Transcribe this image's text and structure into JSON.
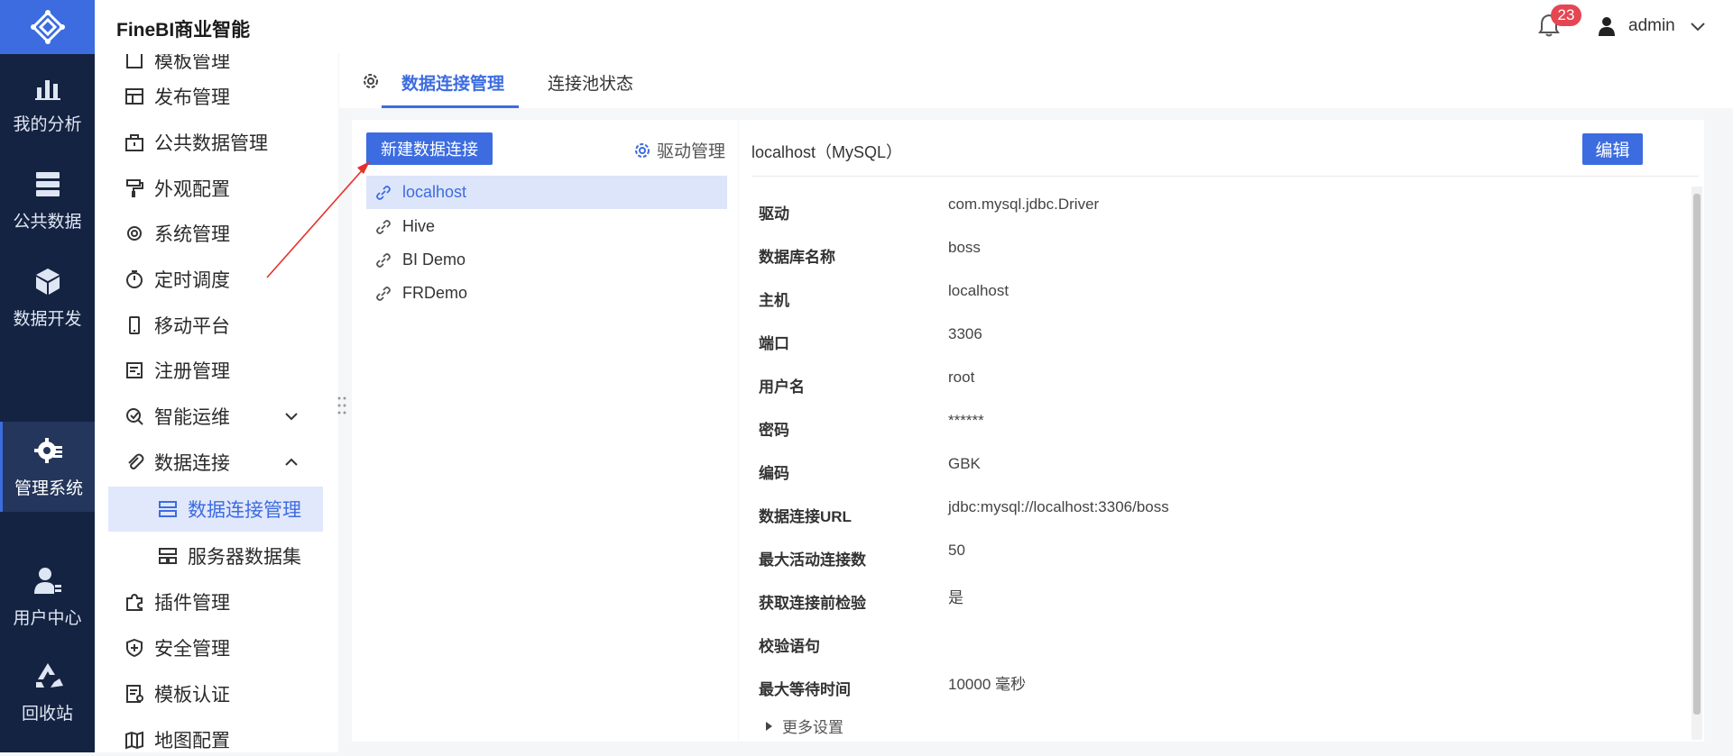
{
  "rail": {
    "items": [
      {
        "label": "我的分析",
        "icon": "bar-chart-icon"
      },
      {
        "label": "公共数据",
        "icon": "database-icon"
      },
      {
        "label": "数据开发",
        "icon": "cube-icon"
      },
      {
        "label": "管理系统",
        "icon": "gear-icon",
        "active": true
      },
      {
        "label": "用户中心",
        "icon": "user-icon"
      },
      {
        "label": "回收站",
        "icon": "recycle-icon"
      }
    ]
  },
  "header": {
    "title": "FineBI商业智能",
    "notification_count": "23",
    "username": "admin"
  },
  "sidebar": {
    "items": [
      {
        "label": "模板管理"
      },
      {
        "label": "发布管理"
      },
      {
        "label": "公共数据管理"
      },
      {
        "label": "外观配置"
      },
      {
        "label": "系统管理"
      },
      {
        "label": "定时调度"
      },
      {
        "label": "移动平台"
      },
      {
        "label": "注册管理"
      },
      {
        "label": "智能运维"
      },
      {
        "label": "数据连接"
      },
      {
        "label": "数据连接管理"
      },
      {
        "label": "服务器数据集"
      },
      {
        "label": "插件管理"
      },
      {
        "label": "安全管理"
      },
      {
        "label": "模板认证"
      },
      {
        "label": "地图配置"
      }
    ]
  },
  "tabs": [
    {
      "label": "数据连接管理",
      "active": true
    },
    {
      "label": "连接池状态"
    }
  ],
  "list": {
    "new_button": "新建数据连接",
    "driver_mgmt": "驱动管理",
    "connections": [
      "localhost",
      "Hive",
      "BI Demo",
      "FRDemo"
    ]
  },
  "detail": {
    "title": "localhost（MySQL）",
    "edit_button": "编辑",
    "fields": [
      {
        "key": "驱动",
        "value": "com.mysql.jdbc.Driver"
      },
      {
        "key": "数据库名称",
        "value": "boss"
      },
      {
        "key": "主机",
        "value": "localhost"
      },
      {
        "key": "端口",
        "value": "3306"
      },
      {
        "key": "用户名",
        "value": "root"
      },
      {
        "key": "密码",
        "value": "******"
      },
      {
        "key": "编码",
        "value": "GBK"
      },
      {
        "key": "数据连接URL",
        "value": "jdbc:mysql://localhost:3306/boss"
      },
      {
        "key": "最大活动连接数",
        "value": "50"
      },
      {
        "key": "获取连接前检验",
        "value": "是"
      },
      {
        "key": "校验语句",
        "value": ""
      },
      {
        "key": "最大等待时间",
        "value": "10000 毫秒"
      }
    ],
    "more_settings": "更多设置"
  },
  "colors": {
    "accent": "#3c6ce0",
    "rail_bg": "#152342",
    "badge": "#e64552",
    "annotation_arrow": "#e8302a"
  }
}
